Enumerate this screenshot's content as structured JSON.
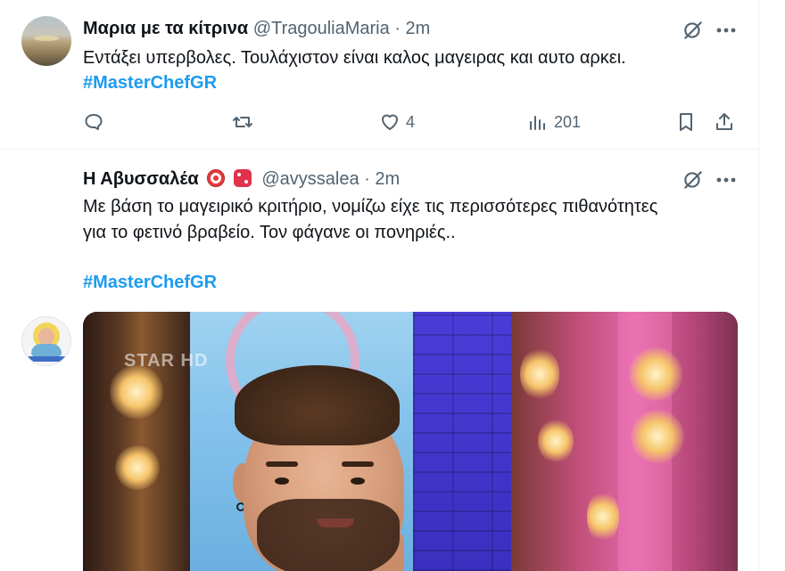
{
  "tweets": [
    {
      "display_name": "Μαρια με τα κίτρινα",
      "handle": "@TragouliaMaria",
      "time": "· 2m",
      "text": "Εντάξει υπερβολες. Τουλάχιστον είναι καλος μαγειρας και αυτο αρκει.",
      "hashtag": "#MasterChefGR",
      "actions": {
        "reply_count": "",
        "retweet_count": "",
        "like_count": "4",
        "views_count": "201"
      }
    },
    {
      "display_name": "Η Αβυσσαλέα",
      "handle": "@avyssalea",
      "time": "· 2m",
      "text_line1": "Με βάση το μαγειρικό κριτήριο, νομίζω είχε τις περισσότερες πιθανότητες",
      "text_line2": "για το φετινό βραβείο. Τον φάγανε οι πονηριές..",
      "hashtag": "#MasterChefGR",
      "media_watermark": "STAR HD"
    }
  ],
  "colors": {
    "accent": "#1d9bf0",
    "text": "#0f1419",
    "muted": "#536471",
    "divider": "#eff3f4"
  },
  "icons": [
    "grok-icon",
    "more-icon",
    "reply-icon",
    "retweet-icon",
    "like-icon",
    "views-icon",
    "bookmark-icon",
    "share-icon"
  ]
}
